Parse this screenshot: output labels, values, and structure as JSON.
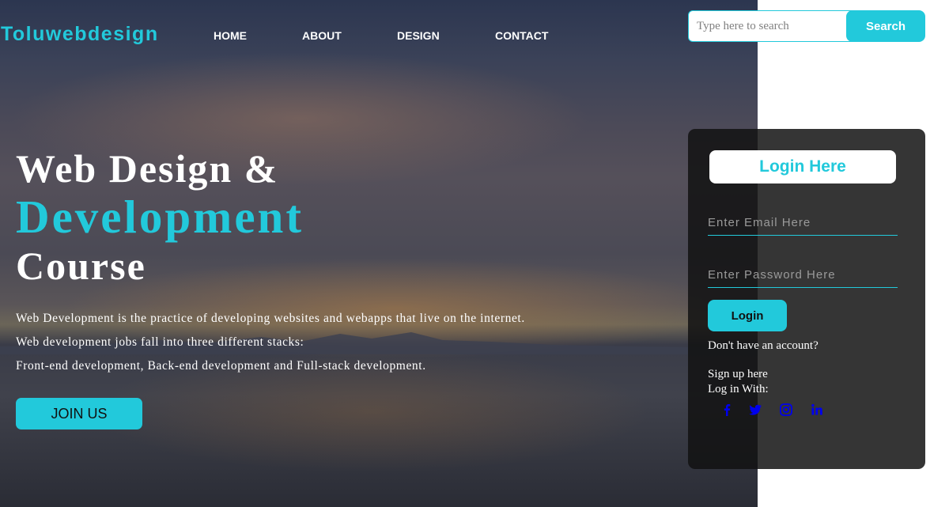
{
  "brand": {
    "logo": "Toluwebdesign",
    "accent_color": "#22c9db"
  },
  "nav": {
    "items": [
      "HOME",
      "ABOUT",
      "DESIGN",
      "CONTACT"
    ]
  },
  "search": {
    "placeholder": "Type here to search",
    "value": "",
    "button_label": "Search"
  },
  "hero": {
    "title_line1": "Web Design &",
    "title_line2": "Development",
    "title_line3": "Course",
    "paragraphs": [
      "Web Development is the practice of developing websites and webapps that live on the internet.",
      "Web development jobs fall into three different stacks:",
      "Front-end development, Back-end development and Full-stack development."
    ],
    "cta_label": "JOIN US"
  },
  "login": {
    "title": "Login Here",
    "email_placeholder": "Enter Email Here",
    "password_placeholder": "Enter Password Here",
    "button_label": "Login",
    "no_account_text": "Don't have an account?",
    "signup_text": "Sign up here",
    "login_with_text": "Log in With:",
    "social_icons": [
      "facebook-icon",
      "twitter-icon",
      "instagram-icon",
      "linkedin-icon"
    ],
    "social_icon_color": "#0000ee"
  }
}
